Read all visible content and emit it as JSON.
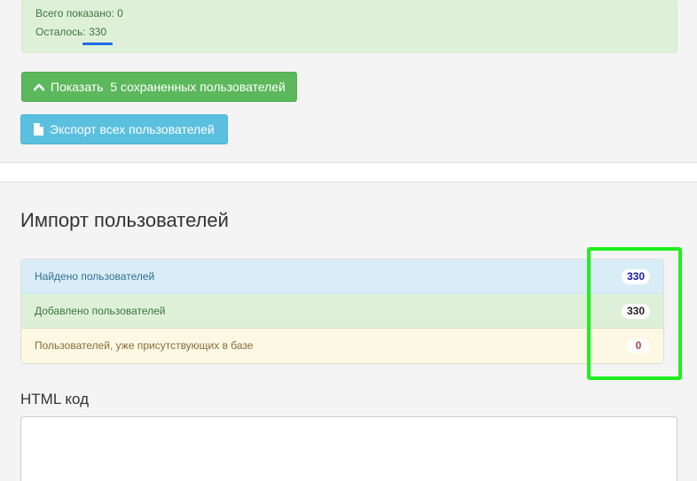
{
  "stats": {
    "shown_label": "Всего показано: 0",
    "remaining_label": "Осталось: ",
    "remaining_value": "330"
  },
  "buttons": {
    "show_saved": "Показать  5 сохраненных пользователей",
    "export_all": "Экспорт всех пользователей"
  },
  "import": {
    "title": "Импорт пользователей",
    "items": [
      {
        "label": "Найдено пользователей",
        "count": "330"
      },
      {
        "label": "Добавлено пользователей",
        "count": "330"
      },
      {
        "label": "Пользователей, уже присутствующих в базе",
        "count": "0"
      }
    ]
  },
  "html_code": {
    "label": "HTML код",
    "value": ""
  },
  "icons": {
    "show_saved": "chevron-up-icon",
    "export_all": "file-icon"
  },
  "colors": {
    "success": "#5cb85c",
    "info": "#5bc0de",
    "highlight": "#1ef01e",
    "underline": "#1e6ee6"
  }
}
